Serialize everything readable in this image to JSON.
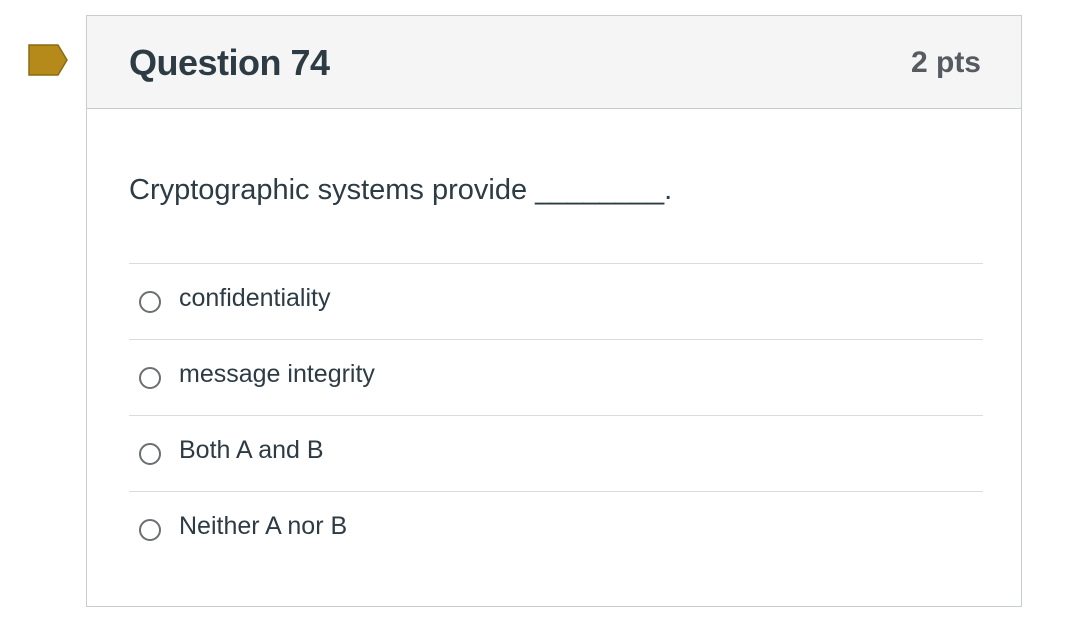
{
  "question": {
    "title": "Question 74",
    "points": "2 pts",
    "text": "Cryptographic systems provide ________.",
    "answers": [
      {
        "label": "confidentiality"
      },
      {
        "label": "message integrity"
      },
      {
        "label": "Both A and B"
      },
      {
        "label": "Neither A nor B"
      }
    ]
  },
  "colors": {
    "flag": "#b58a1b",
    "title": "#2d3b45",
    "points": "#555b60",
    "header_bg": "#f5f5f5",
    "border": "#c7cdd1"
  },
  "icons": {
    "flag": "bookmark-flag-icon",
    "radio": "radio-unchecked-icon"
  }
}
